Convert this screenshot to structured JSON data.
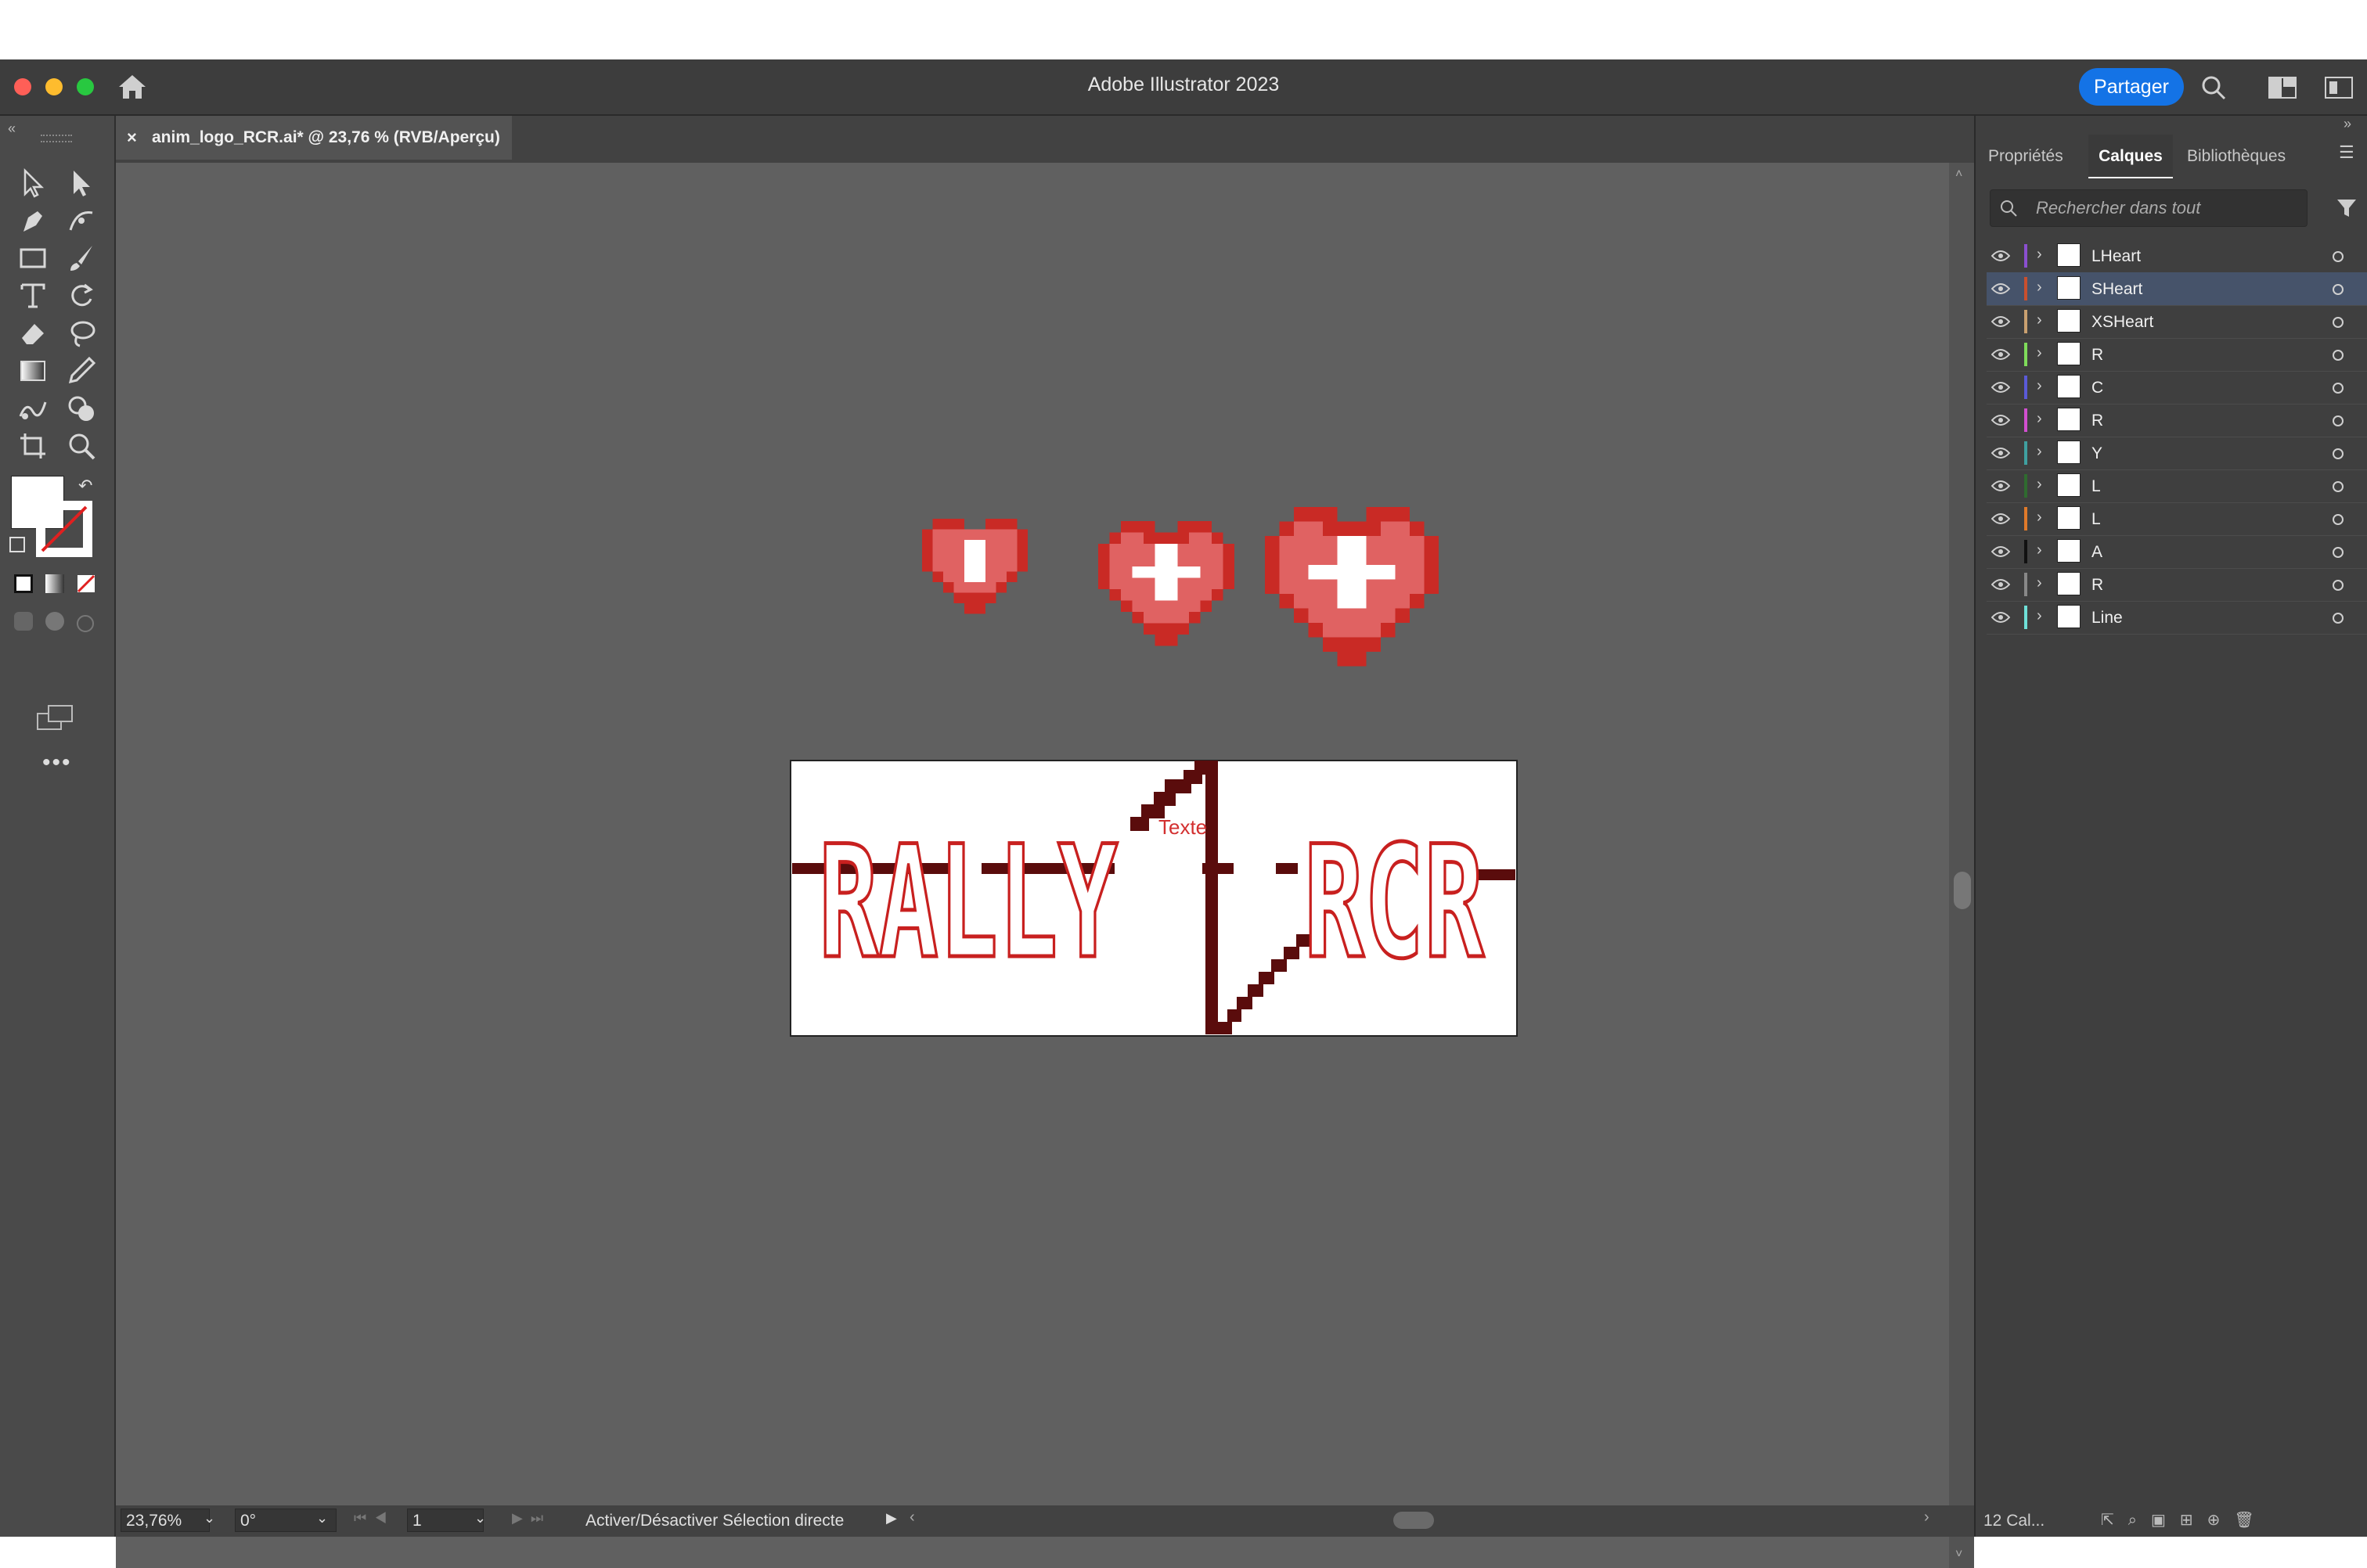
{
  "app": {
    "title": "Adobe Illustrator 2023",
    "share_label": "Partager"
  },
  "document": {
    "tab_title": "anim_logo_RCR.ai* @ 23,76 % (RVB/Aperçu)"
  },
  "artboard": {
    "text_logo_left": "RALLY",
    "text_logo_right": "RCR",
    "text_overlay": "Texte"
  },
  "panel": {
    "tabs": [
      "Propriétés",
      "Calques",
      "Bibliothèques"
    ],
    "active_tab": "Calques",
    "search_placeholder": "Rechercher dans tout",
    "layers": [
      {
        "name": "LHeart",
        "color": "#8a4fd0",
        "selected": false
      },
      {
        "name": "SHeart",
        "color": "#c94f2e",
        "selected": true
      },
      {
        "name": "XSHeart",
        "color": "#c9a070",
        "selected": false
      },
      {
        "name": "R",
        "color": "#7fdc5a",
        "selected": false
      },
      {
        "name": "C",
        "color": "#5a5ad8",
        "selected": false
      },
      {
        "name": "R",
        "color": "#d24fd0",
        "selected": false
      },
      {
        "name": "Y",
        "color": "#3fa0a0",
        "selected": false
      },
      {
        "name": "L",
        "color": "#2f6b2f",
        "selected": false
      },
      {
        "name": "L",
        "color": "#e07a2a",
        "selected": false
      },
      {
        "name": "A",
        "color": "#111111",
        "selected": false
      },
      {
        "name": "R",
        "color": "#888888",
        "selected": false
      },
      {
        "name": "Line",
        "color": "#6fe0d8",
        "selected": false
      }
    ],
    "layer_count": "12 Cal..."
  },
  "statusbar": {
    "zoom": "23,76%",
    "rotation": "0°",
    "artboard_number": "1",
    "tool_status": "Activer/Désactiver Sélection directe"
  },
  "colors": {
    "accent": "#1473e6",
    "heart_dark": "#c92a25",
    "heart_light": "#e06262",
    "logo_red": "#c8201f",
    "line_dark": "#5a0c0c"
  }
}
